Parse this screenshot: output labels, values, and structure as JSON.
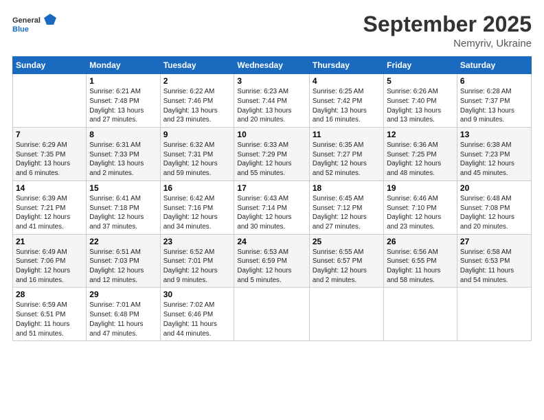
{
  "logo": {
    "line1": "General",
    "line2": "Blue"
  },
  "title": "September 2025",
  "subtitle": "Nemyriv, Ukraine",
  "weekdays": [
    "Sunday",
    "Monday",
    "Tuesday",
    "Wednesday",
    "Thursday",
    "Friday",
    "Saturday"
  ],
  "weeks": [
    [
      {
        "day": "",
        "info": ""
      },
      {
        "day": "1",
        "info": "Sunrise: 6:21 AM\nSunset: 7:48 PM\nDaylight: 13 hours\nand 27 minutes."
      },
      {
        "day": "2",
        "info": "Sunrise: 6:22 AM\nSunset: 7:46 PM\nDaylight: 13 hours\nand 23 minutes."
      },
      {
        "day": "3",
        "info": "Sunrise: 6:23 AM\nSunset: 7:44 PM\nDaylight: 13 hours\nand 20 minutes."
      },
      {
        "day": "4",
        "info": "Sunrise: 6:25 AM\nSunset: 7:42 PM\nDaylight: 13 hours\nand 16 minutes."
      },
      {
        "day": "5",
        "info": "Sunrise: 6:26 AM\nSunset: 7:40 PM\nDaylight: 13 hours\nand 13 minutes."
      },
      {
        "day": "6",
        "info": "Sunrise: 6:28 AM\nSunset: 7:37 PM\nDaylight: 13 hours\nand 9 minutes."
      }
    ],
    [
      {
        "day": "7",
        "info": "Sunrise: 6:29 AM\nSunset: 7:35 PM\nDaylight: 13 hours\nand 6 minutes."
      },
      {
        "day": "8",
        "info": "Sunrise: 6:31 AM\nSunset: 7:33 PM\nDaylight: 13 hours\nand 2 minutes."
      },
      {
        "day": "9",
        "info": "Sunrise: 6:32 AM\nSunset: 7:31 PM\nDaylight: 12 hours\nand 59 minutes."
      },
      {
        "day": "10",
        "info": "Sunrise: 6:33 AM\nSunset: 7:29 PM\nDaylight: 12 hours\nand 55 minutes."
      },
      {
        "day": "11",
        "info": "Sunrise: 6:35 AM\nSunset: 7:27 PM\nDaylight: 12 hours\nand 52 minutes."
      },
      {
        "day": "12",
        "info": "Sunrise: 6:36 AM\nSunset: 7:25 PM\nDaylight: 12 hours\nand 48 minutes."
      },
      {
        "day": "13",
        "info": "Sunrise: 6:38 AM\nSunset: 7:23 PM\nDaylight: 12 hours\nand 45 minutes."
      }
    ],
    [
      {
        "day": "14",
        "info": "Sunrise: 6:39 AM\nSunset: 7:21 PM\nDaylight: 12 hours\nand 41 minutes."
      },
      {
        "day": "15",
        "info": "Sunrise: 6:41 AM\nSunset: 7:18 PM\nDaylight: 12 hours\nand 37 minutes."
      },
      {
        "day": "16",
        "info": "Sunrise: 6:42 AM\nSunset: 7:16 PM\nDaylight: 12 hours\nand 34 minutes."
      },
      {
        "day": "17",
        "info": "Sunrise: 6:43 AM\nSunset: 7:14 PM\nDaylight: 12 hours\nand 30 minutes."
      },
      {
        "day": "18",
        "info": "Sunrise: 6:45 AM\nSunset: 7:12 PM\nDaylight: 12 hours\nand 27 minutes."
      },
      {
        "day": "19",
        "info": "Sunrise: 6:46 AM\nSunset: 7:10 PM\nDaylight: 12 hours\nand 23 minutes."
      },
      {
        "day": "20",
        "info": "Sunrise: 6:48 AM\nSunset: 7:08 PM\nDaylight: 12 hours\nand 20 minutes."
      }
    ],
    [
      {
        "day": "21",
        "info": "Sunrise: 6:49 AM\nSunset: 7:06 PM\nDaylight: 12 hours\nand 16 minutes."
      },
      {
        "day": "22",
        "info": "Sunrise: 6:51 AM\nSunset: 7:03 PM\nDaylight: 12 hours\nand 12 minutes."
      },
      {
        "day": "23",
        "info": "Sunrise: 6:52 AM\nSunset: 7:01 PM\nDaylight: 12 hours\nand 9 minutes."
      },
      {
        "day": "24",
        "info": "Sunrise: 6:53 AM\nSunset: 6:59 PM\nDaylight: 12 hours\nand 5 minutes."
      },
      {
        "day": "25",
        "info": "Sunrise: 6:55 AM\nSunset: 6:57 PM\nDaylight: 12 hours\nand 2 minutes."
      },
      {
        "day": "26",
        "info": "Sunrise: 6:56 AM\nSunset: 6:55 PM\nDaylight: 11 hours\nand 58 minutes."
      },
      {
        "day": "27",
        "info": "Sunrise: 6:58 AM\nSunset: 6:53 PM\nDaylight: 11 hours\nand 54 minutes."
      }
    ],
    [
      {
        "day": "28",
        "info": "Sunrise: 6:59 AM\nSunset: 6:51 PM\nDaylight: 11 hours\nand 51 minutes."
      },
      {
        "day": "29",
        "info": "Sunrise: 7:01 AM\nSunset: 6:48 PM\nDaylight: 11 hours\nand 47 minutes."
      },
      {
        "day": "30",
        "info": "Sunrise: 7:02 AM\nSunset: 6:46 PM\nDaylight: 11 hours\nand 44 minutes."
      },
      {
        "day": "",
        "info": ""
      },
      {
        "day": "",
        "info": ""
      },
      {
        "day": "",
        "info": ""
      },
      {
        "day": "",
        "info": ""
      }
    ]
  ]
}
